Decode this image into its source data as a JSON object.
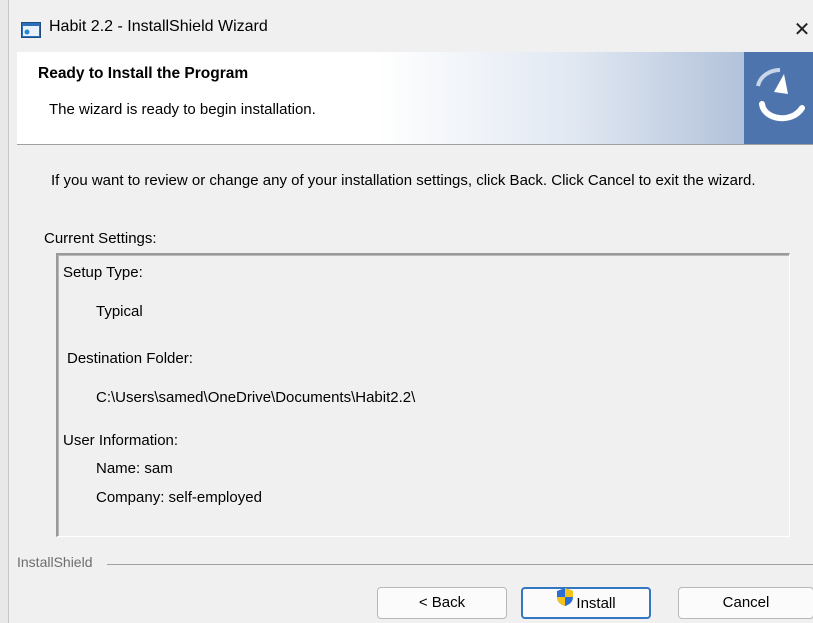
{
  "window": {
    "title": "Habit 2.2 - InstallShield Wizard",
    "close_glyph": "✕"
  },
  "banner": {
    "title": "Ready to Install the Program",
    "subtitle": "The wizard is ready to begin installation."
  },
  "content": {
    "intro": "If you want to review or change any of your installation settings, click Back. Click Cancel to exit the wizard.",
    "current_settings_label": "Current Settings:",
    "settings": {
      "setup_type_label": "Setup Type:",
      "setup_type_value": "Typical",
      "destination_label": "Destination Folder:",
      "destination_value": "C:\\Users\\samed\\OneDrive\\Documents\\Habit2.2\\",
      "user_info_label": "User Information:",
      "name_line": "Name: sam",
      "company_line": "Company: self-employed"
    }
  },
  "footer": {
    "brand": "InstallShield",
    "back_label": "< Back",
    "install_label": "Install",
    "cancel_label": "Cancel"
  },
  "icons": {
    "app": "installer-window-icon",
    "close": "close-icon",
    "logo": "installshield-logo-icon",
    "shield": "uac-shield-icon"
  },
  "colors": {
    "default_button_border": "#3376c2",
    "logo_blue": "#4d74ad"
  }
}
